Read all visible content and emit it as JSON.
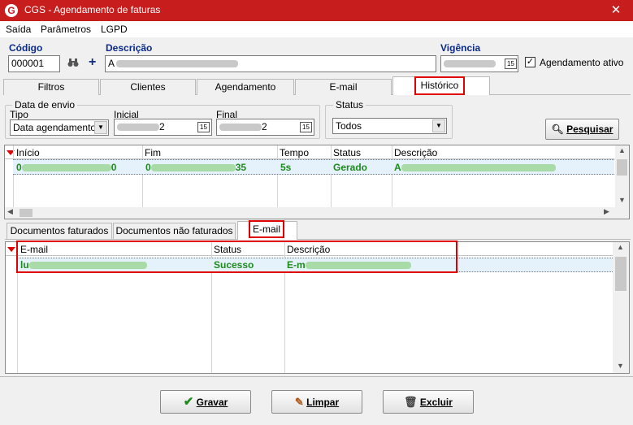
{
  "window": {
    "title": "CGS - Agendamento de faturas",
    "logo": "G",
    "close_glyph": "✕"
  },
  "menu": [
    "Saída",
    "Parâmetros",
    "LGPD"
  ],
  "form": {
    "codigo_label": "Código",
    "codigo_value": "000001",
    "descricao_label": "Descrição",
    "descricao_prefix": "A",
    "vigencia_label": "Vigência",
    "agendamento_ativo_label": "Agendamento ativo",
    "agendamento_ativo_checked": true,
    "calendar_icon_text": "15"
  },
  "tabs": [
    "Filtros",
    "Clientes",
    "Agendamento",
    "E-mail",
    "Histórico"
  ],
  "active_tab": "Histórico",
  "filters": {
    "data_envio_title": "Data de envio",
    "tipo_label": "Tipo",
    "tipo_value": "Data agendamento",
    "inicial_label": "Inicial",
    "inicial_suffix": "2",
    "final_label": "Final",
    "final_suffix": "2",
    "status_title": "Status",
    "status_value": "Todos",
    "pesquisar_label": "Pesquisar"
  },
  "history_grid": {
    "columns": [
      "Início",
      "Fim",
      "Tempo",
      "Status",
      "Descrição"
    ],
    "rows": [
      {
        "inicio_prefix": "0",
        "inicio_suffix": "0",
        "fim_prefix": "0",
        "fim_suffix": "35",
        "tempo": "5s",
        "status": "Gerado",
        "descricao_prefix": "A"
      }
    ]
  },
  "sub_tabs": [
    "Documentos faturados",
    "Documentos não faturados",
    "E-mail"
  ],
  "active_sub_tab": "E-mail",
  "email_grid": {
    "columns": [
      "E-mail",
      "Status",
      "Descrição"
    ],
    "rows": [
      {
        "email_prefix": "lu",
        "status": "Sucesso",
        "descricao_prefix": "E-m"
      }
    ]
  },
  "buttons": {
    "gravar": "Gravar",
    "limpar": "Limpar",
    "excluir": "Excluir"
  },
  "colors": {
    "title_bar": "#c81d1d",
    "highlight_red": "#e00000",
    "success_green": "#1e8a1e",
    "label_blue": "#0b2a8a"
  }
}
